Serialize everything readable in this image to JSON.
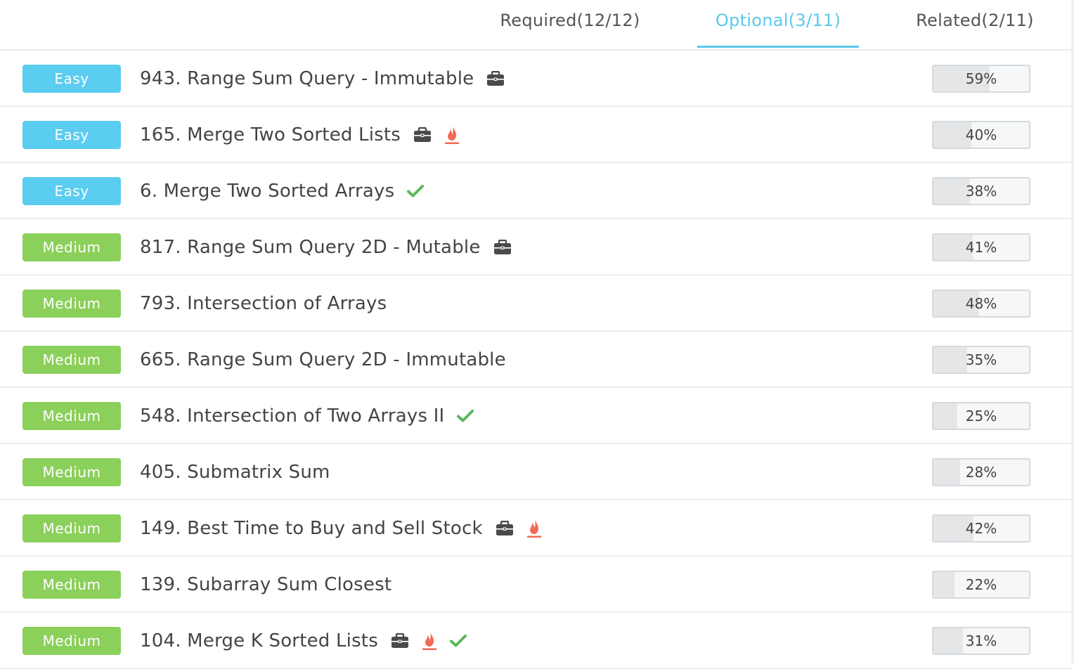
{
  "tabs": [
    {
      "label": "Required(12/12)",
      "active": false
    },
    {
      "label": "Optional(3/11)",
      "active": true
    },
    {
      "label": "Related(2/11)",
      "active": false
    }
  ],
  "colors": {
    "easy": "#5bcdf0",
    "medium": "#8bd05a",
    "accent": "#5bc8ec",
    "fire": "#f06a55",
    "check": "#5cb85c",
    "briefcase": "#4a4a4a"
  },
  "problems": [
    {
      "difficulty": "Easy",
      "title": "943. Range Sum Query - Immutable",
      "icons": [
        "briefcase-icon"
      ],
      "pct": "59%",
      "rate": 0.59
    },
    {
      "difficulty": "Easy",
      "title": "165. Merge Two Sorted Lists",
      "icons": [
        "briefcase-icon",
        "fire-icon"
      ],
      "pct": "40%",
      "rate": 0.4
    },
    {
      "difficulty": "Easy",
      "title": "6. Merge Two Sorted Arrays",
      "icons": [
        "check-icon"
      ],
      "pct": "38%",
      "rate": 0.38
    },
    {
      "difficulty": "Medium",
      "title": "817. Range Sum Query 2D - Mutable",
      "icons": [
        "briefcase-icon"
      ],
      "pct": "41%",
      "rate": 0.41
    },
    {
      "difficulty": "Medium",
      "title": "793. Intersection of Arrays",
      "icons": [],
      "pct": "48%",
      "rate": 0.48
    },
    {
      "difficulty": "Medium",
      "title": "665. Range Sum Query 2D - Immutable",
      "icons": [],
      "pct": "35%",
      "rate": 0.35
    },
    {
      "difficulty": "Medium",
      "title": "548. Intersection of Two Arrays II",
      "icons": [
        "check-icon"
      ],
      "pct": "25%",
      "rate": 0.25
    },
    {
      "difficulty": "Medium",
      "title": "405. Submatrix Sum",
      "icons": [],
      "pct": "28%",
      "rate": 0.28
    },
    {
      "difficulty": "Medium",
      "title": "149. Best Time to Buy and Sell Stock",
      "icons": [
        "briefcase-icon",
        "fire-icon"
      ],
      "pct": "42%",
      "rate": 0.42
    },
    {
      "difficulty": "Medium",
      "title": "139. Subarray Sum Closest",
      "icons": [],
      "pct": "22%",
      "rate": 0.22
    },
    {
      "difficulty": "Medium",
      "title": "104. Merge K Sorted Lists",
      "icons": [
        "briefcase-icon",
        "fire-icon",
        "check-icon"
      ],
      "pct": "31%",
      "rate": 0.31
    }
  ]
}
